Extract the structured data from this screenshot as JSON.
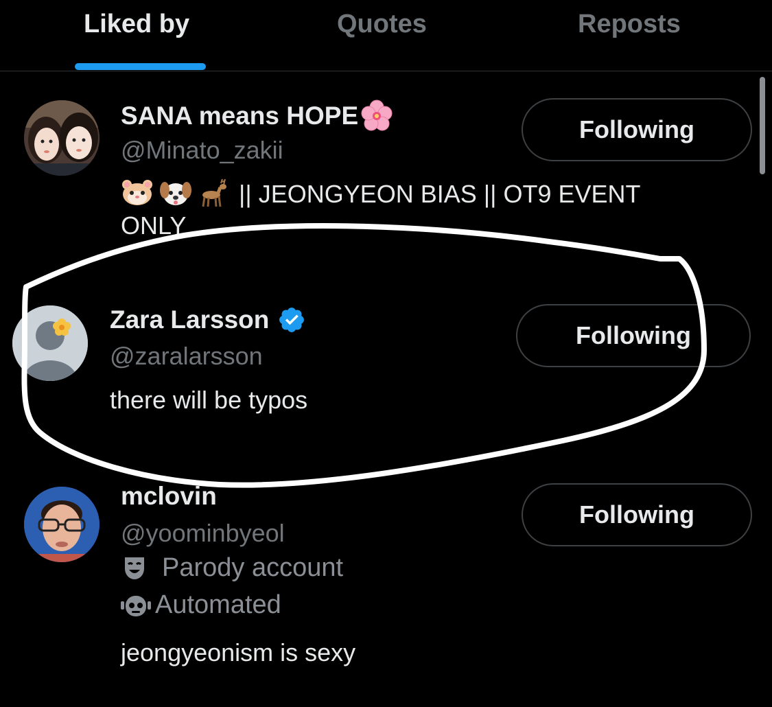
{
  "tabs": [
    {
      "label": "Liked by",
      "active": true
    },
    {
      "label": "Quotes",
      "active": false
    },
    {
      "label": "Reposts",
      "active": false
    }
  ],
  "users": [
    {
      "name": "SANA means HOPE",
      "name_emoji": "cherry-blossom-icon",
      "handle": "@Minato_zakii",
      "bio_emojis": [
        "hamster-face-icon",
        "dog-face-icon",
        "deer-icon"
      ],
      "bio": "|| JEONGYEON BIAS || OT9 EVENT ONLY",
      "button": "Following"
    },
    {
      "name": "Zara Larsson",
      "verified": true,
      "handle": "@zaralarsson",
      "bio": "there will be typos",
      "button": "Following"
    },
    {
      "name": "mclovin",
      "handle": "@yoominbyeol",
      "labels": [
        {
          "icon": "parody-mask-icon",
          "text": "Parody account"
        },
        {
          "icon": "robot-icon",
          "text": "Automated"
        }
      ],
      "bio": "jeongyeonism is sexy",
      "button": "Following"
    }
  ],
  "colors": {
    "background": "#000000",
    "text": "#e7e9ea",
    "muted": "#71767b",
    "accent": "#1d9bf0",
    "verified": "#1d9bf0",
    "annotation": "#ffffff"
  }
}
